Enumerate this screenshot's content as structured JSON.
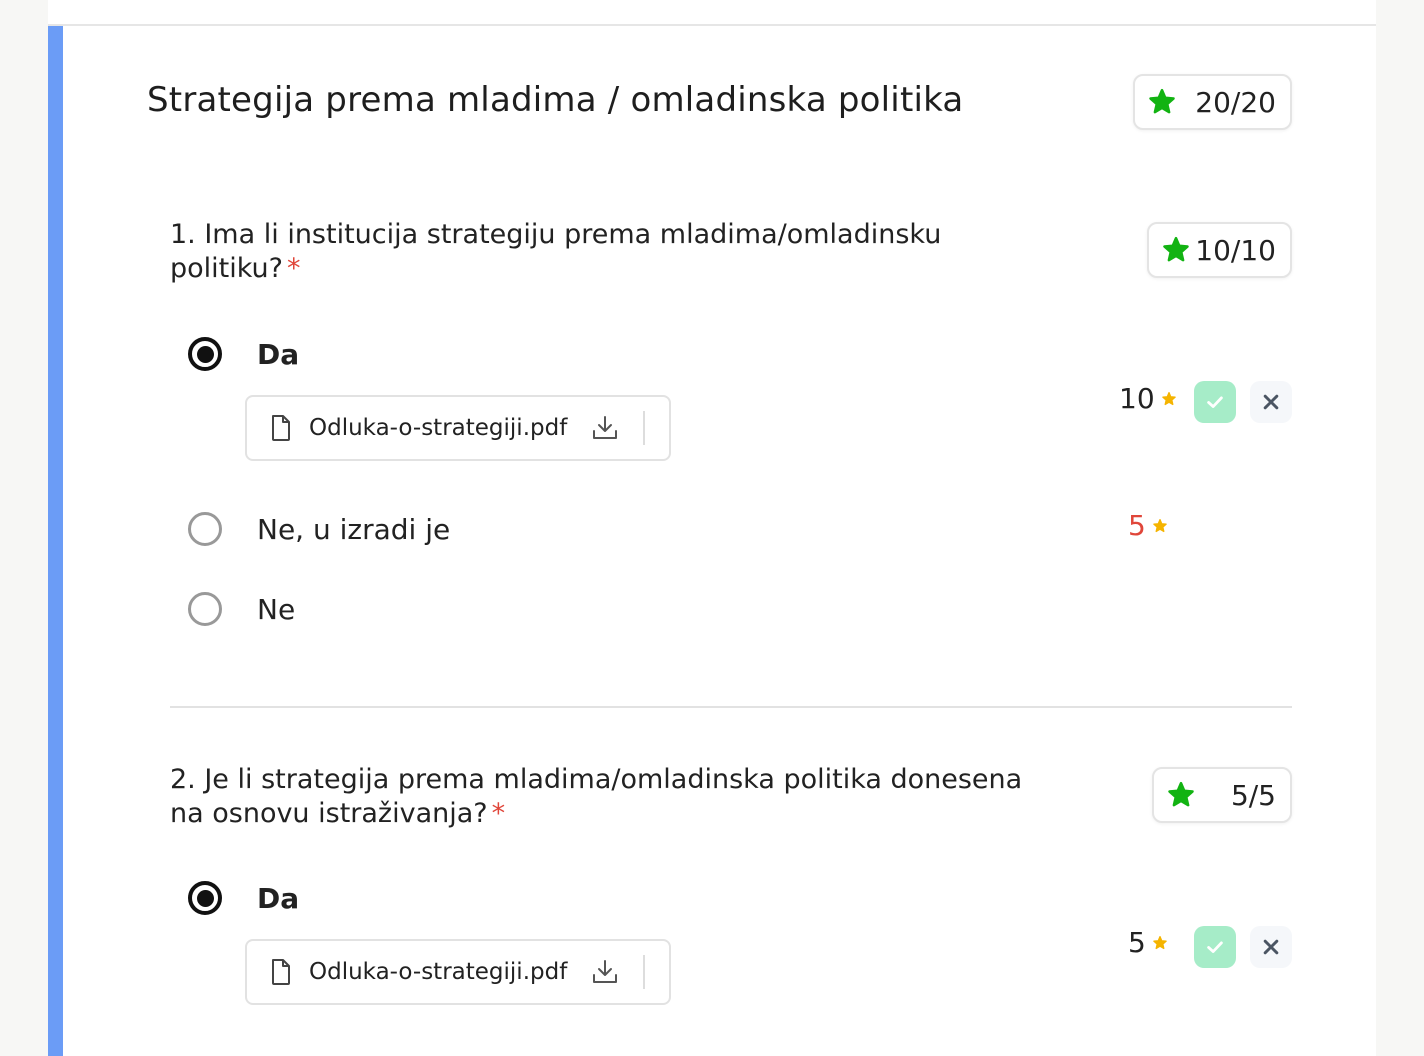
{
  "section": {
    "title": "Strategija prema mladima / omladinska politika",
    "score": "20/20"
  },
  "questions": [
    {
      "number_text": "1. Ima li institucija strategiju prema mladima/omladinsku politiku?",
      "required_mark": "*",
      "score": "10/10",
      "options": [
        {
          "label": "Da",
          "selected": true,
          "points": "10"
        },
        {
          "label": "Ne, u izradi je",
          "selected": false,
          "points": "5"
        },
        {
          "label": "Ne",
          "selected": false,
          "points": ""
        }
      ],
      "attachment": "Odluka-o-strategiji.pdf"
    },
    {
      "number_text": "2. Je li strategija prema mladima/omladinska politika donesena na osnovu istraživanja?",
      "required_mark": "*",
      "score": "5/5",
      "options": [
        {
          "label": "Da",
          "selected": true,
          "points": "5"
        }
      ],
      "attachment": "Odluka-o-strategiji.pdf"
    }
  ],
  "colors": {
    "accent": "#6b9cf6",
    "score_star": "#12b312",
    "points_star": "#f5b400",
    "required": "#e0463a",
    "accept_bg": "#a6ecc8",
    "reject_icon": "#4b5563"
  },
  "icons": {
    "score": "star-icon",
    "file": "file-icon",
    "download": "download-icon",
    "accept": "check-icon",
    "reject": "close-icon"
  }
}
